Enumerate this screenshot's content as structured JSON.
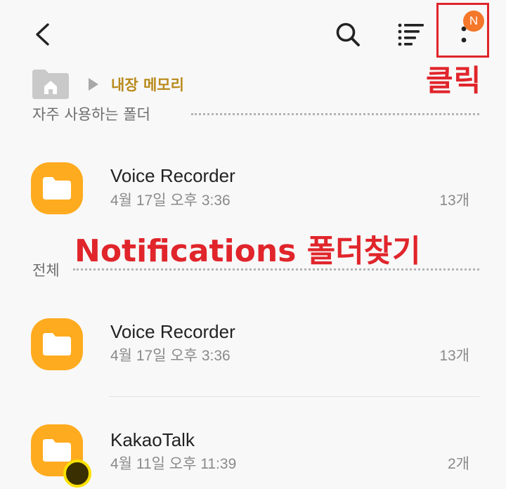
{
  "toolbar": {
    "back_icon": "back-arrow-icon",
    "search_icon": "search-icon",
    "sort_icon": "sort-list-icon",
    "more_icon": "more-vert-icon",
    "notification_badge": "N",
    "badge_color": "#f4772a"
  },
  "breadcrumb": {
    "home_icon": "home-folder-icon",
    "current": "내장 메모리",
    "color": "#b98a1c"
  },
  "sections": {
    "frequent_title": "자주 사용하는 폴더",
    "all_title": "전체"
  },
  "frequent_folders": [
    {
      "name": "Voice Recorder",
      "date": "4월 17일 오후 3:36",
      "count": "13개"
    }
  ],
  "all_folders": [
    {
      "name": "Voice Recorder",
      "date": "4월 17일 오후 3:36",
      "count": "13개"
    },
    {
      "name": "KakaoTalk",
      "date": "4월 11일 오후 11:39",
      "count": "2개"
    }
  ],
  "annotations": {
    "click_label": "클릭",
    "find_label": "Notifications 폴더찾기",
    "color": "#e0252b"
  },
  "colors": {
    "folder": "#ffab1f",
    "background": "#f8f8f8"
  }
}
